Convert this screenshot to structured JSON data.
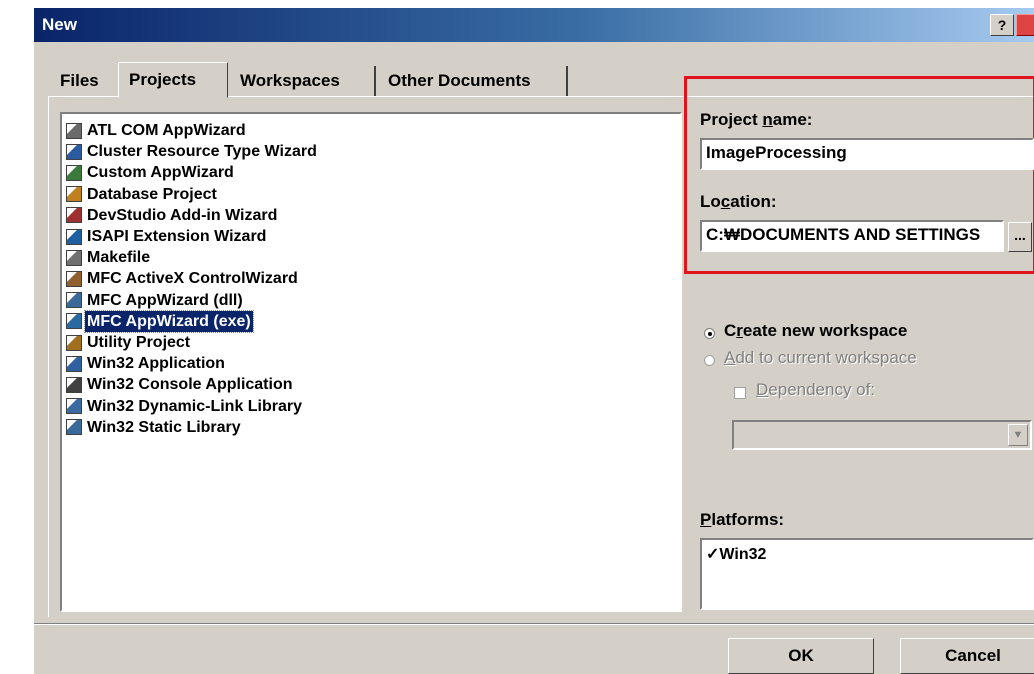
{
  "window": {
    "title": "New",
    "help_label": "?"
  },
  "tabs": [
    "Files",
    "Projects",
    "Workspaces",
    "Other Documents"
  ],
  "project_types": [
    {
      "label": "ATL COM AppWizard",
      "icon": "atl-wizard-icon"
    },
    {
      "label": "Cluster Resource Type Wizard",
      "icon": "cluster-wizard-icon"
    },
    {
      "label": "Custom AppWizard",
      "icon": "custom-wizard-icon"
    },
    {
      "label": "Database Project",
      "icon": "database-icon"
    },
    {
      "label": "DevStudio Add-in Wizard",
      "icon": "addin-wizard-icon"
    },
    {
      "label": "ISAPI Extension Wizard",
      "icon": "globe-icon"
    },
    {
      "label": "Makefile",
      "icon": "makefile-icon"
    },
    {
      "label": "MFC ActiveX ControlWizard",
      "icon": "activex-icon"
    },
    {
      "label": "MFC AppWizard (dll)",
      "icon": "mfc-dll-icon"
    },
    {
      "label": "MFC AppWizard (exe)",
      "icon": "mfc-exe-icon"
    },
    {
      "label": "Utility Project",
      "icon": "utility-icon"
    },
    {
      "label": "Win32 Application",
      "icon": "win32-app-icon"
    },
    {
      "label": "Win32 Console Application",
      "icon": "console-icon"
    },
    {
      "label": "Win32 Dynamic-Link Library",
      "icon": "dll-icon"
    },
    {
      "label": "Win32 Static Library",
      "icon": "static-lib-icon"
    }
  ],
  "selected_index": 9,
  "project_name": {
    "label_pre": "Project ",
    "label_key": "n",
    "label_post": "ame:",
    "value": "ImageProcessing"
  },
  "location": {
    "label_pre": "Lo",
    "label_key": "c",
    "label_post": "ation:",
    "value": "C:₩DOCUMENTS AND SETTINGS",
    "browse_label": "..."
  },
  "workspace": {
    "create_pre": "C",
    "create_key": "r",
    "create_post": "eate new workspace",
    "add_key": "A",
    "add_post": "dd to current workspace",
    "dependency_key": "D",
    "dependency_post": "ependency of:",
    "combo_arrow": "▼"
  },
  "platforms": {
    "label_key": "P",
    "label_post": "latforms:",
    "items": [
      {
        "label": "Win32",
        "checked": true,
        "mark": "✓"
      }
    ]
  },
  "buttons": {
    "ok": "OK",
    "cancel": "Cancel"
  },
  "colors": {
    "accent_highlight": "#e0141e",
    "selection": "#0a246a"
  }
}
